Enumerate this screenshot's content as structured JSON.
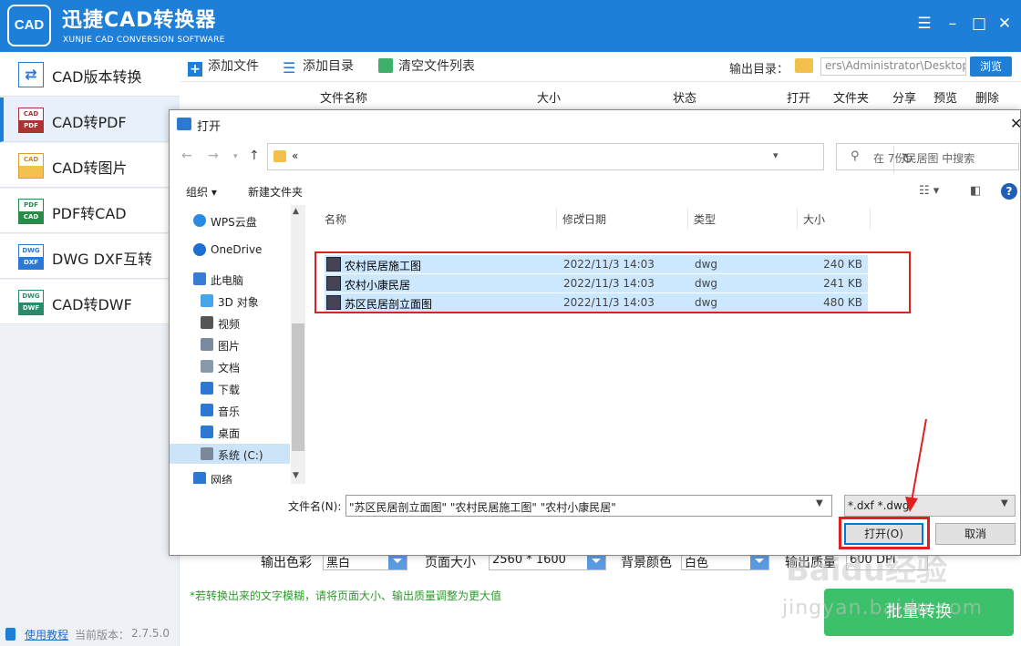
{
  "app": {
    "title": "迅捷CAD转换器",
    "subtitle": "XUNJIE CAD CONVERSION SOFTWARE",
    "logo_text": "CAD"
  },
  "sidebar": {
    "items": [
      {
        "label": "CAD版本转换",
        "icon": [
          "",
          ""
        ]
      },
      {
        "label": "CAD转PDF",
        "icon": [
          "CAD",
          "PDF"
        ]
      },
      {
        "label": "CAD转图片",
        "icon": [
          "CAD",
          ""
        ]
      },
      {
        "label": "PDF转CAD",
        "icon": [
          "PDF",
          "CAD"
        ]
      },
      {
        "label": "DWG DXF互转",
        "icon": [
          "DWG",
          "DXF"
        ]
      },
      {
        "label": "CAD转DWF",
        "icon": [
          "DWG",
          "DWF"
        ]
      }
    ],
    "active_index": 1,
    "help_link": "使用教程",
    "version_label": "当前版本：",
    "version": "2.7.5.0"
  },
  "toolbar": {
    "add_file": "添加文件",
    "add_dir": "添加目录",
    "clear_list": "清空文件列表",
    "output_label": "输出目录：",
    "output_path": "ers\\Administrator\\Desktop",
    "browse": "浏览"
  },
  "table": {
    "columns": [
      "文件名称",
      "大小",
      "状态",
      "打开",
      "文件夹",
      "分享",
      "预览",
      "删除"
    ]
  },
  "options": {
    "color_label": "输出色彩",
    "color_value": "黑白",
    "page_label": "页面大小",
    "page_value": "2560 * 1600",
    "bg_label": "背景颜色",
    "bg_value": "白色",
    "quality_label": "输出质量",
    "quality_value": "600 DPI"
  },
  "hint": "*若转换出来的文字模糊，请将页面大小、输出质量调整为更大值",
  "convert_button": "批量转换",
  "watermark": {
    "text": "Baidu经验",
    "url": "jingyan.baidu.com"
  },
  "dialog": {
    "title": "打开",
    "address": "«",
    "search_placeholder": "在 7份民居图 中搜索",
    "organize": "组织",
    "new_folder": "新建文件夹",
    "tree": [
      {
        "label": "WPS云盘",
        "icon": "cloud-icon",
        "color": "#2a8be0"
      },
      {
        "label": "OneDrive",
        "icon": "onedrive-icon",
        "color": "#1e6fd0"
      },
      {
        "label": "此电脑",
        "icon": "computer-icon",
        "color": "#3a7bd5"
      },
      {
        "label": "3D 对象",
        "icon": "cube-icon",
        "color": "#48a4e8"
      },
      {
        "label": "视频",
        "icon": "video-icon",
        "color": "#555"
      },
      {
        "label": "图片",
        "icon": "picture-icon",
        "color": "#7a8aa0"
      },
      {
        "label": "文档",
        "icon": "document-icon",
        "color": "#8899aa"
      },
      {
        "label": "下载",
        "icon": "download-icon",
        "color": "#2b79d4"
      },
      {
        "label": "音乐",
        "icon": "music-icon",
        "color": "#2b79d4"
      },
      {
        "label": "桌面",
        "icon": "desktop-icon",
        "color": "#2b79d4"
      },
      {
        "label": "系统 (C:)",
        "icon": "drive-icon",
        "color": "#7a8899"
      },
      {
        "label": "网络",
        "icon": "network-icon",
        "color": "#2b79d4"
      }
    ],
    "tree_selected": 10,
    "columns": [
      "名称",
      "修改日期",
      "类型",
      "大小"
    ],
    "files": [
      {
        "name": "农村民居施工图",
        "date": "2022/11/3 14:03",
        "type": "dwg",
        "size": "240 KB"
      },
      {
        "name": "农村小康民居",
        "date": "2022/11/3 14:03",
        "type": "dwg",
        "size": "241 KB"
      },
      {
        "name": "苏区民居剖立面图",
        "date": "2022/11/3 14:03",
        "type": "dwg",
        "size": "480 KB"
      }
    ],
    "filename_label": "文件名(N):",
    "filename_value": "\"苏区民居剖立面图\" \"农村民居施工图\" \"农村小康民居\"",
    "filetype": "*.dxf *.dwg",
    "open_button": "打开(O)",
    "cancel_button": "取消"
  },
  "colors": {
    "brand": "#1e7fd8",
    "convert": "#3cc06a",
    "highlight": "#e02020",
    "selection": "#cce8ff"
  }
}
